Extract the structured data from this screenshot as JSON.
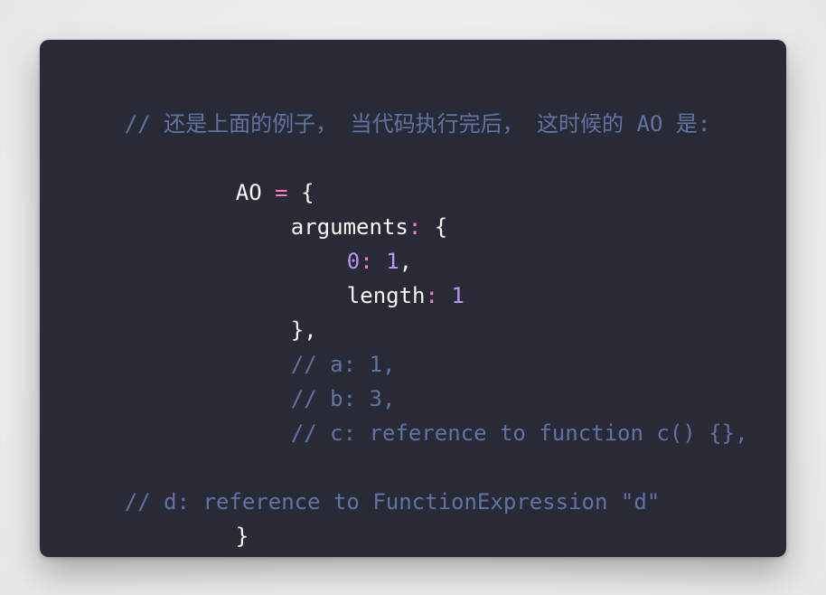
{
  "colors": {
    "page_background": "#ececec",
    "card_background": "#282a36",
    "comment": "#6272a4",
    "plain": "#f8f8f2",
    "operator": "#ff79c6",
    "number": "#bd93f9"
  },
  "code": {
    "line_01_comment": "// 还是上面的例子， 当代码执行完后， 这时候的 AO 是:",
    "line_03_ao": "AO",
    "line_03_equals": " = ",
    "line_03_brace": "{",
    "line_04_key": "arguments",
    "line_04_colon": ":",
    "line_04_brace": " {",
    "line_05_zero": "0",
    "line_05_colon": ":",
    "line_05_one": " 1",
    "line_05_comma": ",",
    "line_06_key": "length",
    "line_06_colon": ":",
    "line_06_one": " 1",
    "line_07_close": "},",
    "line_08_comment": "// a: 1,",
    "line_09_comment": "// b: 3,",
    "line_10_comment": "// c: reference to function c() {},",
    "line_12_comment": "// d: reference to FunctionExpression \"d\"",
    "line_13_close": "}"
  }
}
